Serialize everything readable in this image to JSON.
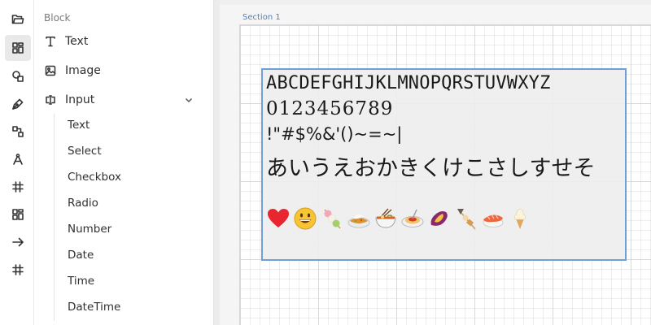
{
  "rail": {
    "items": [
      {
        "name": "folder-icon"
      },
      {
        "name": "blocks-icon",
        "active": true
      },
      {
        "name": "shapes-icon"
      },
      {
        "name": "pen-icon"
      },
      {
        "name": "link-nodes-icon"
      },
      {
        "name": "compass-icon"
      },
      {
        "name": "grid-hash-icon"
      },
      {
        "name": "layout-icon"
      },
      {
        "name": "arrow-right-icon"
      },
      {
        "name": "hash-icon"
      }
    ]
  },
  "panel": {
    "title": "Block",
    "items": [
      {
        "label": "Text",
        "icon": "text-icon"
      },
      {
        "label": "Image",
        "icon": "image-icon"
      },
      {
        "label": "Input",
        "icon": "input-icon",
        "expanded": true
      }
    ],
    "sub_items": [
      "Text",
      "Select",
      "Checkbox",
      "Radio",
      "Number",
      "Date",
      "Time",
      "DateTime"
    ]
  },
  "canvas": {
    "section_label": "Section 1",
    "schema": {
      "line1": "ABCDEFGHIJKLMNOPQRSTUVWXYZ",
      "line2": "0123456789",
      "line3": "!\"#$%&'()~=~|",
      "line4": "あいうえおかきくけこさしすせそ",
      "emojis": [
        "heart",
        "grinning-face",
        "dango",
        "curry-rice",
        "ramen",
        "spaghetti",
        "roasted-sweet-potato",
        "oden",
        "sushi",
        "soft-ice-cream"
      ]
    }
  },
  "colors": {
    "accent": "#4a82c4",
    "selection_border": "#6f9fd6"
  }
}
